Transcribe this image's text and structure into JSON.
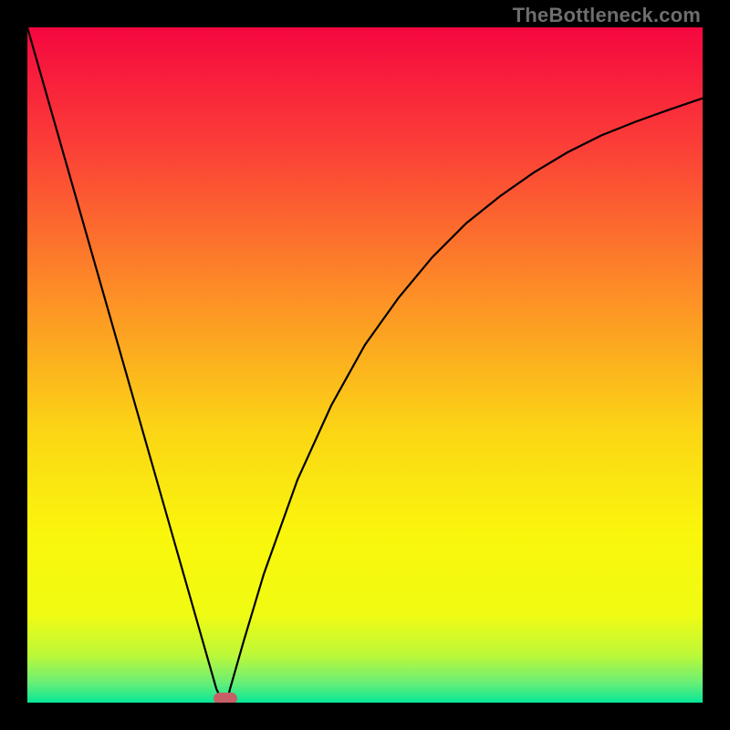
{
  "watermark": "TheBottleneck.com",
  "chart_data": {
    "type": "line",
    "title": "",
    "xlabel": "",
    "ylabel": "",
    "xlim": [
      0,
      100
    ],
    "ylim": [
      0,
      100
    ],
    "grid": false,
    "series": [
      {
        "name": "bottleneck-curve",
        "x": [
          0,
          4,
          8,
          12,
          16,
          20,
          24,
          26,
          28,
          29,
          29.5,
          30,
          32,
          35,
          40,
          45,
          50,
          55,
          60,
          65,
          70,
          75,
          80,
          85,
          90,
          95,
          100
        ],
        "values": [
          100,
          86,
          72,
          58,
          44,
          30,
          16,
          9,
          2,
          0,
          0,
          2,
          9,
          19,
          33,
          44,
          53,
          60,
          66,
          71,
          75,
          78.5,
          81.5,
          84,
          86,
          87.8,
          89.5
        ]
      }
    ],
    "minimum_point": {
      "x": 29.3,
      "y": 0
    },
    "background_gradient_stops": [
      {
        "pos": 0,
        "color": "#f5073f"
      },
      {
        "pos": 18,
        "color": "#fb4037"
      },
      {
        "pos": 40,
        "color": "#fd9026"
      },
      {
        "pos": 60,
        "color": "#fbd615"
      },
      {
        "pos": 75,
        "color": "#faf60c"
      },
      {
        "pos": 87,
        "color": "#f0fb13"
      },
      {
        "pos": 93,
        "color": "#bcf838"
      },
      {
        "pos": 97,
        "color": "#6aef75"
      },
      {
        "pos": 100,
        "color": "#07e798"
      }
    ],
    "marker": {
      "color": "#c76066"
    }
  }
}
